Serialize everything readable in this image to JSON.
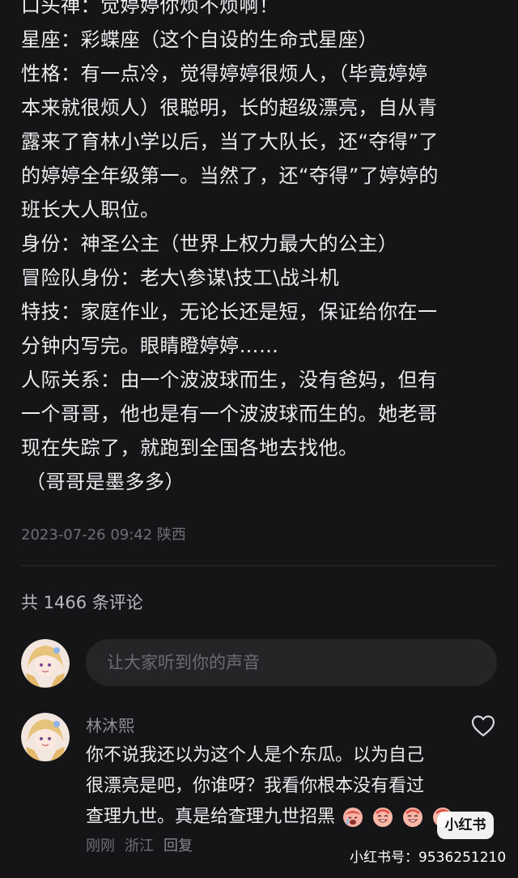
{
  "post": {
    "lines": [
      "口头禅：觉婷婷你烦不烦啊！",
      "星座：彩蝶座（这个自设的生命式星座）",
      "性格：有一点冷，觉得婷婷很烦人，（毕竟婷婷",
      "本来就很烦人）很聪明，长的超级漂亮，自从青",
      "露来了育林小学以后，当了大队长，还“夺得”了",
      "的婷婷全年级第一。当然了，还“夺得”了婷婷的",
      "班长大人职位。",
      "身份：神圣公主（世界上权力最大的公主）",
      "冒险队身份：老大\\参谋\\技工\\战斗机",
      "特技：家庭作业，无论长还是短，保证给你在一",
      "分钟内写完。眼睛瞪婷婷……",
      "人际关系：由一个波波球而生，没有爸妈，但有",
      "一个哥哥，他也是有一个波波球而生的。她老哥",
      "现在失踪了，就跑到全国各地去找他。",
      "（哥哥是墨多多）"
    ],
    "meta": "2023-07-26 09:42 陕西"
  },
  "comments_header": {
    "count_label": "共 1466 条评论"
  },
  "composer": {
    "placeholder": "让大家听到你的声音"
  },
  "comment": {
    "author": "林沐熙",
    "lines": [
      "你不说我还以为这个人是个东瓜。以为自己",
      "很漂亮是吧，你谁呀？我看你根本没有看过",
      "查理九世。真是给查理九世招黑"
    ],
    "emojis": [
      "crying-face-emoji",
      "laughing-face-emoji",
      "laughing-face-emoji",
      "laughing-face-emoji"
    ],
    "time": "刚刚",
    "location": "浙江",
    "reply_label": "回复"
  },
  "watermark": {
    "badge": "小红书",
    "id_text": "小红书号：9536251210"
  },
  "colors": {
    "background": "#151518",
    "text": "#ececef",
    "muted": "#6e6e74",
    "input_bg": "#252528"
  }
}
